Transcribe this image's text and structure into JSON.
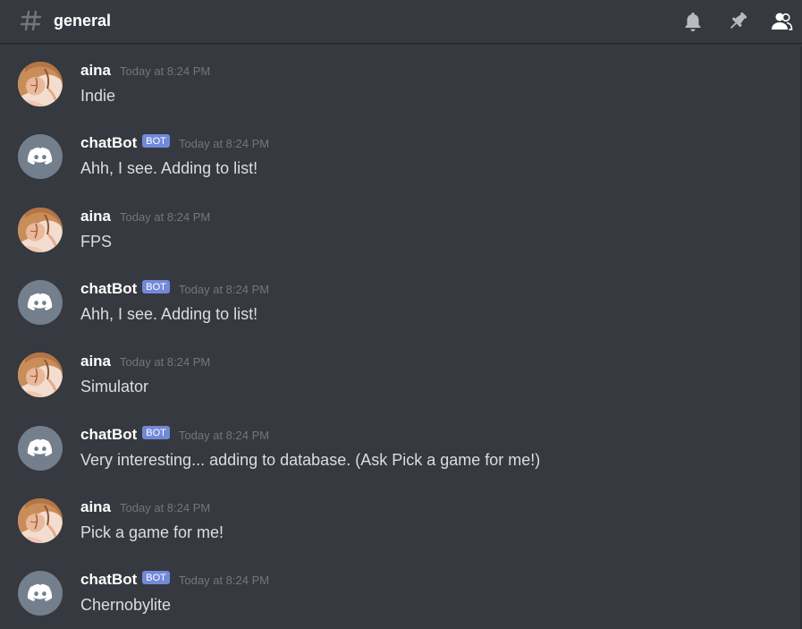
{
  "header": {
    "channel_icon": "hash-icon",
    "channel_name": "general",
    "icons": [
      "bell-icon",
      "pin-icon",
      "members-icon"
    ]
  },
  "colors": {
    "background": "#36393f",
    "bot_tag": "#7289da",
    "username": "#ffffff",
    "timestamp": "#72767d",
    "message_text": "#dcddde"
  },
  "messages": [
    {
      "author": "aina",
      "bot": false,
      "timestamp": "Today at 8:24 PM",
      "text": "Indie"
    },
    {
      "author": "chatBot",
      "bot": true,
      "bot_tag": "BOT",
      "timestamp": "Today at 8:24 PM",
      "text": "Ahh, I see. Adding to list!"
    },
    {
      "author": "aina",
      "bot": false,
      "timestamp": "Today at 8:24 PM",
      "text": "FPS"
    },
    {
      "author": "chatBot",
      "bot": true,
      "bot_tag": "BOT",
      "timestamp": "Today at 8:24 PM",
      "text": "Ahh, I see. Adding to list!"
    },
    {
      "author": "aina",
      "bot": false,
      "timestamp": "Today at 8:24 PM",
      "text": "Simulator"
    },
    {
      "author": "chatBot",
      "bot": true,
      "bot_tag": "BOT",
      "timestamp": "Today at 8:24 PM",
      "text": "Very interesting... adding to database. (Ask Pick a game for me!)"
    },
    {
      "author": "aina",
      "bot": false,
      "timestamp": "Today at 8:24 PM",
      "text": "Pick a game for me!"
    },
    {
      "author": "chatBot",
      "bot": true,
      "bot_tag": "BOT",
      "timestamp": "Today at 8:24 PM",
      "text": "Chernobylite"
    }
  ]
}
